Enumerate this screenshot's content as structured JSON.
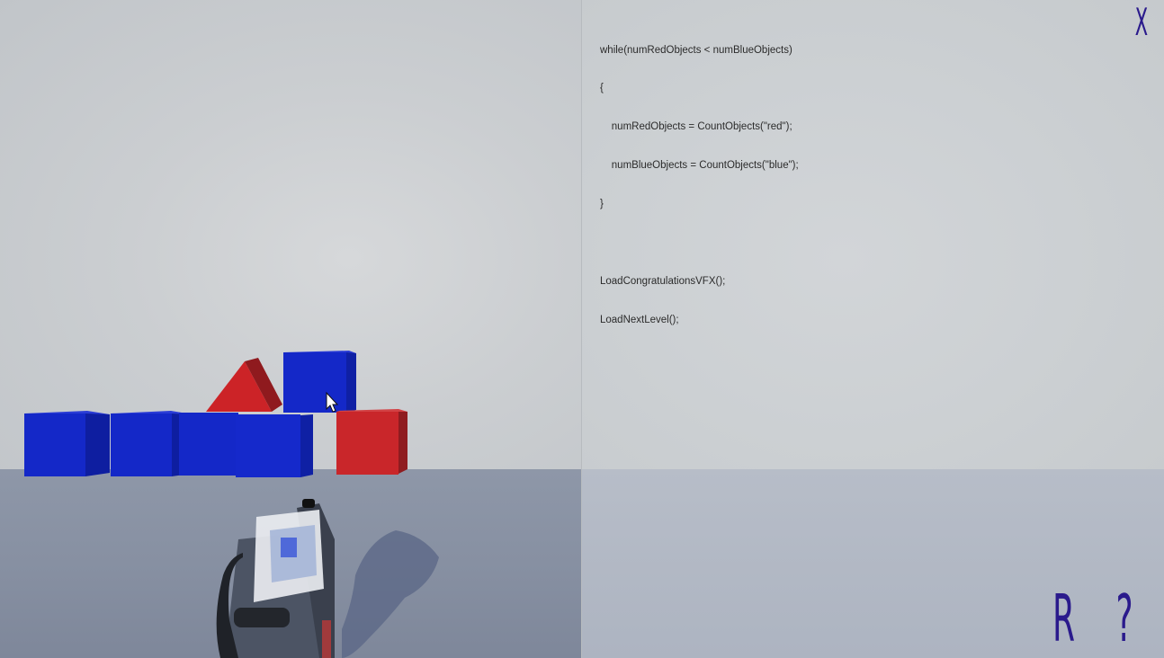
{
  "scene": {
    "colors": {
      "red": "#c0282b",
      "blue": "#1326c4",
      "ui_accent": "#2a1a8c"
    },
    "objects": [
      {
        "kind": "cube",
        "color": "blue"
      },
      {
        "kind": "cube",
        "color": "blue"
      },
      {
        "kind": "cube",
        "color": "blue"
      },
      {
        "kind": "cube",
        "color": "blue"
      },
      {
        "kind": "cube",
        "color": "blue"
      },
      {
        "kind": "triangle",
        "color": "red"
      },
      {
        "kind": "cube",
        "color": "red"
      }
    ],
    "cursor_icon": "mouse-pointer-icon",
    "tool_icon": "handheld-gun-icon"
  },
  "code": {
    "lines": [
      "while(numRedObjects < numBlueObjects)",
      "{",
      "    numRedObjects = CountObjects(\"red\");",
      "    numBlueObjects = CountObjects(\"blue\");",
      "}",
      "",
      "LoadCongratulationsVFX();",
      "LoadNextLevel();"
    ]
  },
  "hud": {
    "close_label": "X",
    "restart_label": "R",
    "help_label": "?"
  }
}
